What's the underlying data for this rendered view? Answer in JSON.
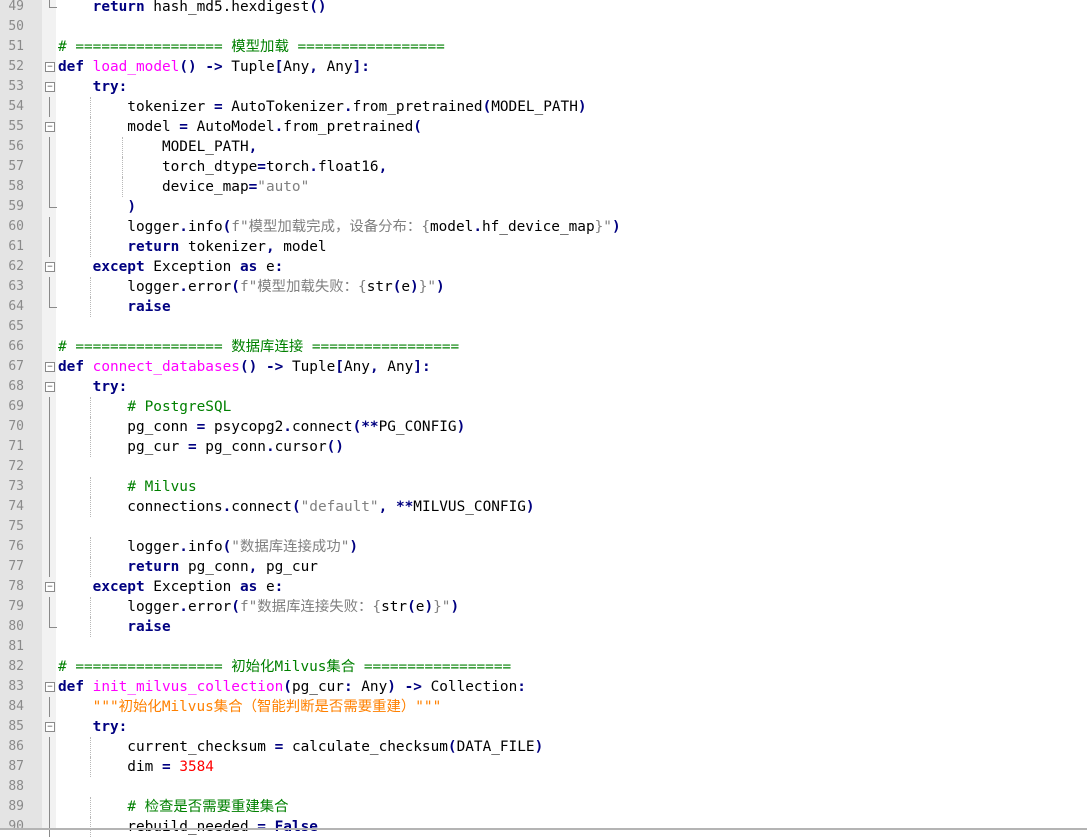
{
  "editor": {
    "lines": [
      {
        "n": "49",
        "fold": "end",
        "segs": [
          [
            "    ",
            "n"
          ],
          [
            "return",
            "kw"
          ],
          [
            " hash_md5.hexdigest",
            "n"
          ],
          [
            "()",
            "op"
          ]
        ]
      },
      {
        "n": "50",
        "fold": "",
        "segs": []
      },
      {
        "n": "51",
        "fold": "",
        "segs": [
          [
            "# ================= 模型加载 =================",
            "cm"
          ]
        ]
      },
      {
        "n": "52",
        "fold": "open",
        "segs": [
          [
            "def",
            "kw"
          ],
          [
            " ",
            "n"
          ],
          [
            "load_model",
            "fn"
          ],
          [
            "()",
            "op"
          ],
          [
            " ",
            "n"
          ],
          [
            "->",
            "op"
          ],
          [
            " Tuple",
            "n"
          ],
          [
            "[",
            "op"
          ],
          [
            "Any",
            "n"
          ],
          [
            ",",
            "op"
          ],
          [
            " Any",
            "n"
          ],
          [
            "]:",
            "op"
          ]
        ]
      },
      {
        "n": "53",
        "fold": "open",
        "segs": [
          [
            "    ",
            "n"
          ],
          [
            "try",
            "kw"
          ],
          [
            ":",
            "op"
          ]
        ]
      },
      {
        "n": "54",
        "fold": "bar",
        "segs": [
          [
            "        tokenizer ",
            "n"
          ],
          [
            "=",
            "op"
          ],
          [
            " AutoTokenizer",
            "n"
          ],
          [
            ".",
            "op"
          ],
          [
            "from_pretrained",
            "n"
          ],
          [
            "(",
            "op"
          ],
          [
            "MODEL_PATH",
            "n"
          ],
          [
            ")",
            "op"
          ]
        ]
      },
      {
        "n": "55",
        "fold": "open",
        "segs": [
          [
            "        model ",
            "n"
          ],
          [
            "=",
            "op"
          ],
          [
            " AutoModel",
            "n"
          ],
          [
            ".",
            "op"
          ],
          [
            "from_pretrained",
            "n"
          ],
          [
            "(",
            "op"
          ]
        ]
      },
      {
        "n": "56",
        "fold": "bar",
        "segs": [
          [
            "            MODEL_PATH",
            "n"
          ],
          [
            ",",
            "op"
          ]
        ]
      },
      {
        "n": "57",
        "fold": "bar",
        "segs": [
          [
            "            torch_dtype",
            "n"
          ],
          [
            "=",
            "op"
          ],
          [
            "torch",
            "n"
          ],
          [
            ".",
            "op"
          ],
          [
            "float16",
            "n"
          ],
          [
            ",",
            "op"
          ]
        ]
      },
      {
        "n": "58",
        "fold": "bar",
        "segs": [
          [
            "            device_map",
            "n"
          ],
          [
            "=",
            "op"
          ],
          [
            "\"auto\"",
            "st"
          ]
        ]
      },
      {
        "n": "59",
        "fold": "end",
        "segs": [
          [
            "        ",
            "n"
          ],
          [
            ")",
            "op"
          ]
        ]
      },
      {
        "n": "60",
        "fold": "bar",
        "segs": [
          [
            "        logger",
            "n"
          ],
          [
            ".",
            "op"
          ],
          [
            "info",
            "n"
          ],
          [
            "(",
            "op"
          ],
          [
            "f\"模型加载完成，设备分布：{",
            "st"
          ],
          [
            "model",
            "n"
          ],
          [
            ".",
            "op"
          ],
          [
            "hf_device_map",
            "n"
          ],
          [
            "}\"",
            "st"
          ],
          [
            ")",
            "op"
          ]
        ]
      },
      {
        "n": "61",
        "fold": "bar",
        "segs": [
          [
            "        ",
            "n"
          ],
          [
            "return",
            "kw"
          ],
          [
            " tokenizer",
            "n"
          ],
          [
            ",",
            "op"
          ],
          [
            " model",
            "n"
          ]
        ]
      },
      {
        "n": "62",
        "fold": "open",
        "segs": [
          [
            "    ",
            "n"
          ],
          [
            "except",
            "kw"
          ],
          [
            " Exception ",
            "n"
          ],
          [
            "as",
            "kw"
          ],
          [
            " e",
            "n"
          ],
          [
            ":",
            "op"
          ]
        ]
      },
      {
        "n": "63",
        "fold": "bar",
        "segs": [
          [
            "        logger",
            "n"
          ],
          [
            ".",
            "op"
          ],
          [
            "error",
            "n"
          ],
          [
            "(",
            "op"
          ],
          [
            "f\"模型加载失败：{",
            "st"
          ],
          [
            "str",
            "n"
          ],
          [
            "(",
            "op"
          ],
          [
            "e",
            "n"
          ],
          [
            ")",
            "op"
          ],
          [
            "}\"",
            "st"
          ],
          [
            ")",
            "op"
          ]
        ]
      },
      {
        "n": "64",
        "fold": "end",
        "segs": [
          [
            "        ",
            "n"
          ],
          [
            "raise",
            "kw"
          ]
        ]
      },
      {
        "n": "65",
        "fold": "",
        "segs": []
      },
      {
        "n": "66",
        "fold": "",
        "segs": [
          [
            "# ================= 数据库连接 =================",
            "cm"
          ]
        ]
      },
      {
        "n": "67",
        "fold": "open",
        "segs": [
          [
            "def",
            "kw"
          ],
          [
            " ",
            "n"
          ],
          [
            "connect_databases",
            "fn"
          ],
          [
            "()",
            "op"
          ],
          [
            " ",
            "n"
          ],
          [
            "->",
            "op"
          ],
          [
            " Tuple",
            "n"
          ],
          [
            "[",
            "op"
          ],
          [
            "Any",
            "n"
          ],
          [
            ",",
            "op"
          ],
          [
            " Any",
            "n"
          ],
          [
            "]:",
            "op"
          ]
        ]
      },
      {
        "n": "68",
        "fold": "open",
        "segs": [
          [
            "    ",
            "n"
          ],
          [
            "try",
            "kw"
          ],
          [
            ":",
            "op"
          ]
        ]
      },
      {
        "n": "69",
        "fold": "bar",
        "segs": [
          [
            "        ",
            "n"
          ],
          [
            "# PostgreSQL",
            "cm"
          ]
        ]
      },
      {
        "n": "70",
        "fold": "bar",
        "segs": [
          [
            "        pg_conn ",
            "n"
          ],
          [
            "=",
            "op"
          ],
          [
            " psycopg2",
            "n"
          ],
          [
            ".",
            "op"
          ],
          [
            "connect",
            "n"
          ],
          [
            "(**",
            "op"
          ],
          [
            "PG_CONFIG",
            "n"
          ],
          [
            ")",
            "op"
          ]
        ]
      },
      {
        "n": "71",
        "fold": "bar",
        "segs": [
          [
            "        pg_cur ",
            "n"
          ],
          [
            "=",
            "op"
          ],
          [
            " pg_conn",
            "n"
          ],
          [
            ".",
            "op"
          ],
          [
            "cursor",
            "n"
          ],
          [
            "()",
            "op"
          ]
        ]
      },
      {
        "n": "72",
        "fold": "bar",
        "segs": []
      },
      {
        "n": "73",
        "fold": "bar",
        "segs": [
          [
            "        ",
            "n"
          ],
          [
            "# Milvus",
            "cm"
          ]
        ]
      },
      {
        "n": "74",
        "fold": "bar",
        "segs": [
          [
            "        connections",
            "n"
          ],
          [
            ".",
            "op"
          ],
          [
            "connect",
            "n"
          ],
          [
            "(",
            "op"
          ],
          [
            "\"default\"",
            "st"
          ],
          [
            ",",
            "op"
          ],
          [
            " ",
            "n"
          ],
          [
            "**",
            "op"
          ],
          [
            "MILVUS_CONFIG",
            "n"
          ],
          [
            ")",
            "op"
          ]
        ]
      },
      {
        "n": "75",
        "fold": "bar",
        "segs": []
      },
      {
        "n": "76",
        "fold": "bar",
        "segs": [
          [
            "        logger",
            "n"
          ],
          [
            ".",
            "op"
          ],
          [
            "info",
            "n"
          ],
          [
            "(",
            "op"
          ],
          [
            "\"数据库连接成功\"",
            "st"
          ],
          [
            ")",
            "op"
          ]
        ]
      },
      {
        "n": "77",
        "fold": "bar",
        "segs": [
          [
            "        ",
            "n"
          ],
          [
            "return",
            "kw"
          ],
          [
            " pg_conn",
            "n"
          ],
          [
            ",",
            "op"
          ],
          [
            " pg_cur",
            "n"
          ]
        ]
      },
      {
        "n": "78",
        "fold": "open",
        "segs": [
          [
            "    ",
            "n"
          ],
          [
            "except",
            "kw"
          ],
          [
            " Exception ",
            "n"
          ],
          [
            "as",
            "kw"
          ],
          [
            " e",
            "n"
          ],
          [
            ":",
            "op"
          ]
        ]
      },
      {
        "n": "79",
        "fold": "bar",
        "segs": [
          [
            "        logger",
            "n"
          ],
          [
            ".",
            "op"
          ],
          [
            "error",
            "n"
          ],
          [
            "(",
            "op"
          ],
          [
            "f\"数据库连接失败：{",
            "st"
          ],
          [
            "str",
            "n"
          ],
          [
            "(",
            "op"
          ],
          [
            "e",
            "n"
          ],
          [
            ")",
            "op"
          ],
          [
            "}\"",
            "st"
          ],
          [
            ")",
            "op"
          ]
        ]
      },
      {
        "n": "80",
        "fold": "end",
        "segs": [
          [
            "        ",
            "n"
          ],
          [
            "raise",
            "kw"
          ]
        ]
      },
      {
        "n": "81",
        "fold": "",
        "segs": []
      },
      {
        "n": "82",
        "fold": "",
        "segs": [
          [
            "# ================= 初始化Milvus集合 =================",
            "cm"
          ]
        ]
      },
      {
        "n": "83",
        "fold": "open",
        "segs": [
          [
            "def",
            "kw"
          ],
          [
            " ",
            "n"
          ],
          [
            "init_milvus_collection",
            "fn"
          ],
          [
            "(",
            "op"
          ],
          [
            "pg_cur",
            "n"
          ],
          [
            ":",
            "op"
          ],
          [
            " Any",
            "n"
          ],
          [
            ")",
            "op"
          ],
          [
            " ",
            "n"
          ],
          [
            "->",
            "op"
          ],
          [
            " Collection",
            "n"
          ],
          [
            ":",
            "op"
          ]
        ]
      },
      {
        "n": "84",
        "fold": "bar",
        "segs": [
          [
            "    ",
            "n"
          ],
          [
            "\"\"\"初始化Milvus集合（智能判断是否需要重建）\"\"\"",
            "dc"
          ]
        ]
      },
      {
        "n": "85",
        "fold": "open",
        "segs": [
          [
            "    ",
            "n"
          ],
          [
            "try",
            "kw"
          ],
          [
            ":",
            "op"
          ]
        ]
      },
      {
        "n": "86",
        "fold": "bar",
        "segs": [
          [
            "        current_checksum ",
            "n"
          ],
          [
            "=",
            "op"
          ],
          [
            " calculate_checksum",
            "n"
          ],
          [
            "(",
            "op"
          ],
          [
            "DATA_FILE",
            "n"
          ],
          [
            ")",
            "op"
          ]
        ]
      },
      {
        "n": "87",
        "fold": "bar",
        "segs": [
          [
            "        dim ",
            "n"
          ],
          [
            "=",
            "op"
          ],
          [
            " ",
            "n"
          ],
          [
            "3584",
            "nm"
          ]
        ]
      },
      {
        "n": "88",
        "fold": "bar",
        "segs": []
      },
      {
        "n": "89",
        "fold": "bar",
        "segs": [
          [
            "        ",
            "n"
          ],
          [
            "# 检查是否需要重建集合",
            "cm"
          ]
        ]
      },
      {
        "n": "90",
        "fold": "bar",
        "segs": [
          [
            "        rebuild_needed ",
            "n"
          ],
          [
            "=",
            "op"
          ],
          [
            " ",
            "n"
          ],
          [
            "False",
            "kw"
          ]
        ]
      }
    ]
  }
}
